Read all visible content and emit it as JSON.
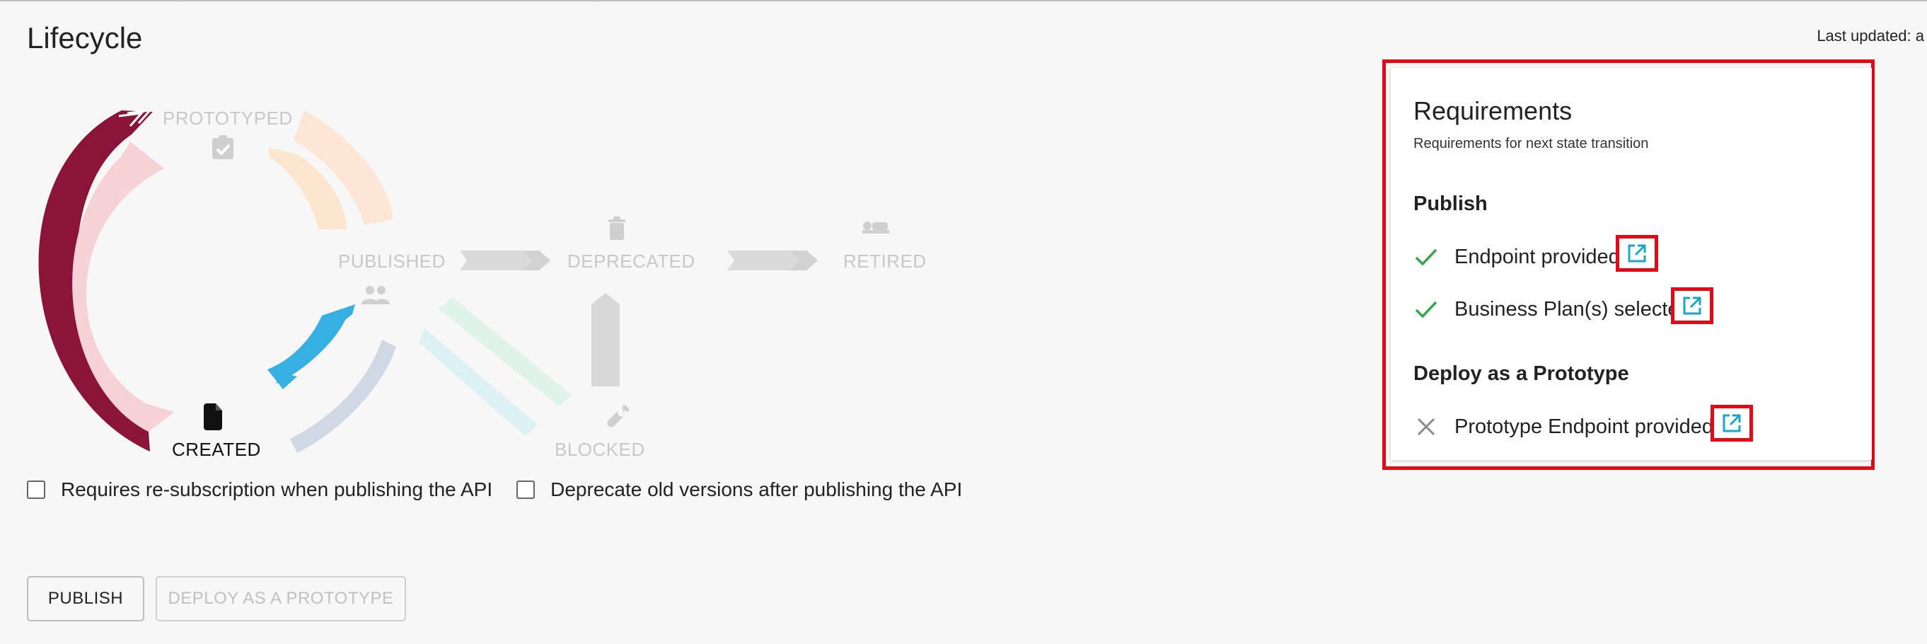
{
  "page": {
    "title": "Lifecycle",
    "last_updated_label": "Last updated: a"
  },
  "states": {
    "created": "CREATED",
    "prototyped": "PROTOTYPED",
    "published": "PUBLISHED",
    "deprecated": "DEPRECATED",
    "retired": "RETIRED",
    "blocked": "BLOCKED"
  },
  "options": {
    "resubscription": "Requires re-subscription when publishing the API",
    "deprecate_old": "Deprecate old versions after publishing the API"
  },
  "actions": {
    "publish": "PUBLISH",
    "deploy_prototype": "DEPLOY AS A PROTOTYPE"
  },
  "requirements": {
    "title": "Requirements",
    "subtitle": "Requirements for next state transition",
    "sections": [
      {
        "heading": "Publish",
        "items": [
          {
            "label": "Endpoint provided",
            "status": "check-icon"
          },
          {
            "label": "Business Plan(s) selected",
            "status": "check-icon"
          }
        ]
      },
      {
        "heading": "Deploy as a Prototype",
        "items": [
          {
            "label": "Prototype Endpoint provided",
            "status": "cross-icon"
          }
        ]
      }
    ]
  },
  "colors": {
    "accent_red": "#e30a17",
    "arrow_maroon": "#8b1538",
    "arrow_blue": "#3aaee0",
    "check_green": "#3aa54a",
    "link_teal": "#1aa6c6"
  }
}
